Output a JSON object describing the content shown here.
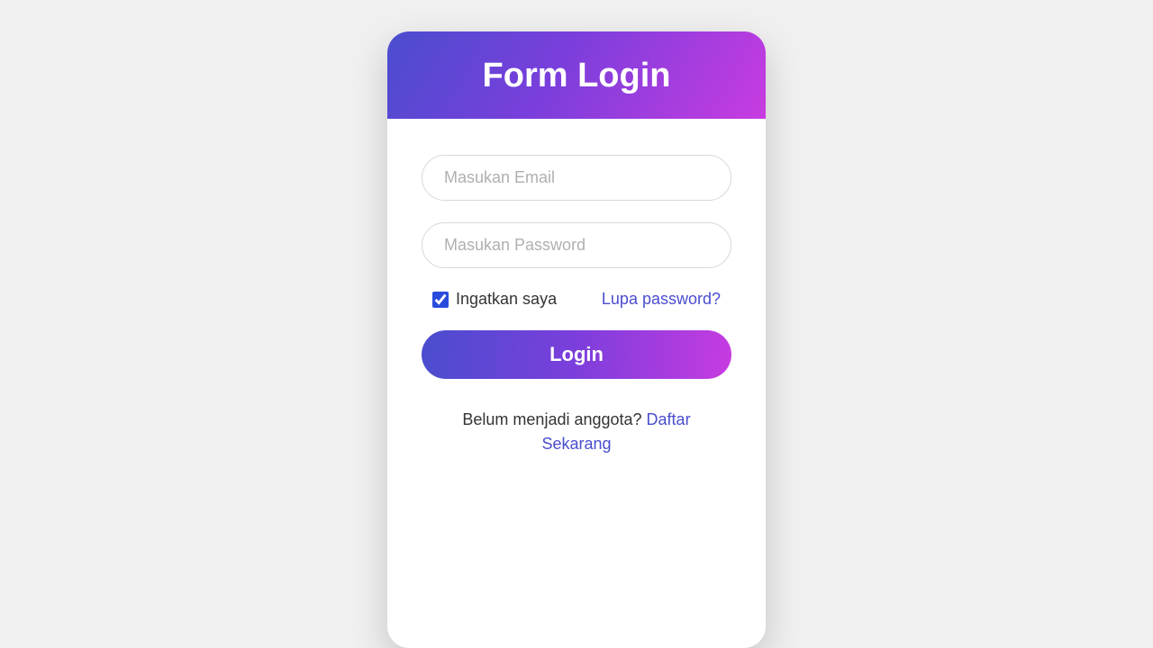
{
  "header": {
    "title": "Form Login"
  },
  "form": {
    "email": {
      "placeholder": "Masukan Email",
      "value": ""
    },
    "password": {
      "placeholder": "Masukan Password",
      "value": ""
    },
    "remember_label": "Ingatkan saya",
    "forgot_label": "Lupa password?",
    "login_button": "Login"
  },
  "footer": {
    "prompt": "Belum menjadi anggota? ",
    "link": "Daftar Sekarang"
  }
}
